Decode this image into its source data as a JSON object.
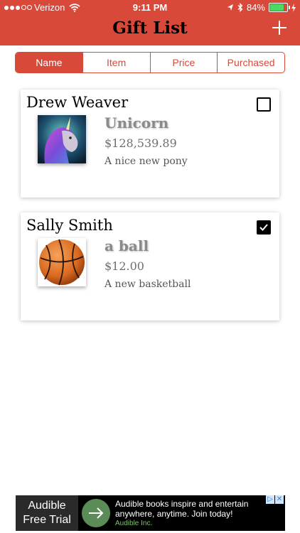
{
  "status_bar": {
    "carrier": "Verizon",
    "time": "9:11 PM",
    "battery": "84%",
    "battery_level": 0.84
  },
  "nav": {
    "title": "Gift List",
    "add_icon": "plus-icon"
  },
  "segments": [
    {
      "label": "Name",
      "selected": true
    },
    {
      "label": "Item",
      "selected": false
    },
    {
      "label": "Price",
      "selected": false
    },
    {
      "label": "Purchased",
      "selected": false
    }
  ],
  "gifts": [
    {
      "person": "Drew Weaver",
      "item": "Unicorn",
      "price": "$128,539.89",
      "description": "A nice new pony",
      "purchased": false,
      "image_icon": "unicorn-image"
    },
    {
      "person": "Sally Smith",
      "item": "a ball",
      "price": "$12.00",
      "description": "A new basketball",
      "purchased": true,
      "image_icon": "basketball-image"
    }
  ],
  "ad": {
    "brand_line1": "Audible",
    "brand_line2": "Free Trial",
    "headline_line1": "Audible books inspire and entertain",
    "headline_line2": "anywhere, anytime. Join today!",
    "sponsor": "Audible Inc."
  },
  "colors": {
    "accent": "#d9493a",
    "battery": "#4cd964"
  }
}
